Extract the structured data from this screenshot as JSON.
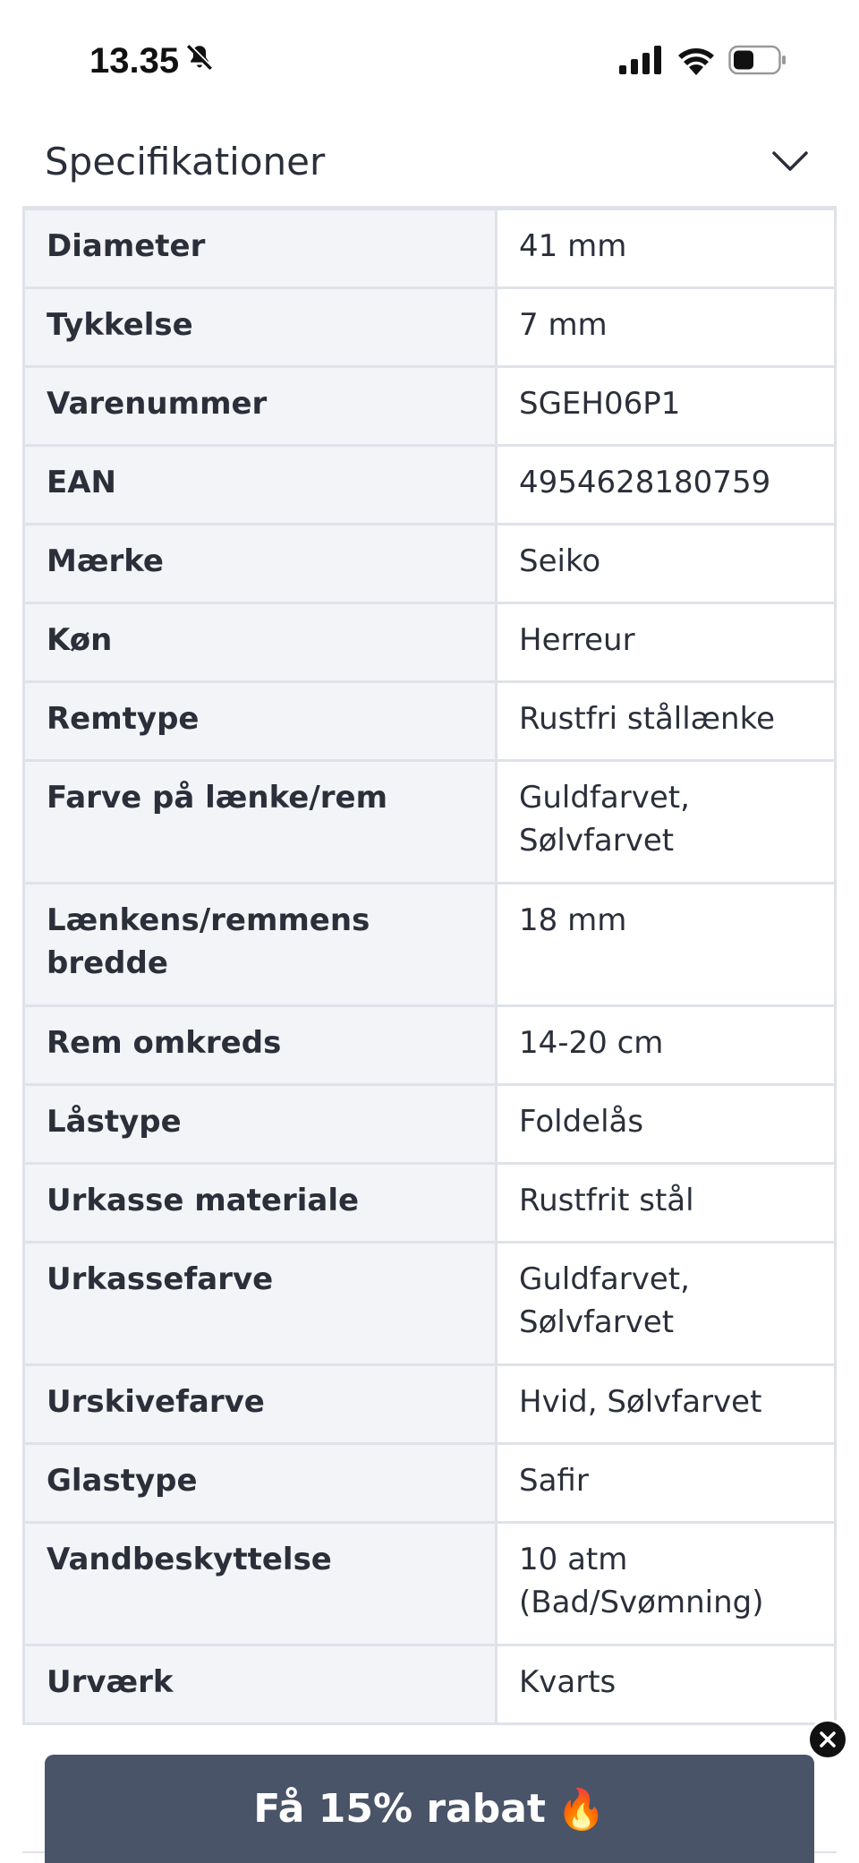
{
  "status_bar": {
    "time": "13.35",
    "icons": [
      "bell-slash-icon",
      "cellular-signal-icon",
      "wifi-icon",
      "battery-icon"
    ]
  },
  "section": {
    "title": "Specifikationer",
    "expand_icon": "chevron-down-icon"
  },
  "specs": [
    {
      "label": "Diameter",
      "value": "41 mm"
    },
    {
      "label": "Tykkelse",
      "value": "7 mm"
    },
    {
      "label": "Varenummer",
      "value": "SGEH06P1"
    },
    {
      "label": "EAN",
      "value": "4954628180759"
    },
    {
      "label": "Mærke",
      "value": "Seiko"
    },
    {
      "label": "Køn",
      "value": "Herreur"
    },
    {
      "label": "Remtype",
      "value": "Rustfri stållænke"
    },
    {
      "label": "Farve på lænke/rem",
      "value_lines": [
        "Guldfarvet,",
        "Sølvfarvet"
      ]
    },
    {
      "label_lines": [
        "Lænkens/remmens",
        "bredde"
      ],
      "value": "18 mm"
    },
    {
      "label": "Rem omkreds",
      "value": "14-20 cm"
    },
    {
      "label": "Låstype",
      "value": "Foldelås"
    },
    {
      "label": "Urkasse materiale",
      "value": "Rustfrit stål"
    },
    {
      "label": "Urkassefarve",
      "value_lines": [
        "Guldfarvet,",
        "Sølvfarvet"
      ]
    },
    {
      "label": "Urskivefarve",
      "value": "Hvid, Sølvfarvet"
    },
    {
      "label": "Glastype",
      "value": "Safir"
    },
    {
      "label": "Vandbeskyttelse",
      "value_lines": [
        "10 atm",
        "(Bad/Svømning)"
      ]
    },
    {
      "label": "Urværk",
      "value": "Kvarts"
    }
  ],
  "promo": {
    "label": "Få 15% rabat",
    "emoji": "🔥",
    "close_icon": "close-icon",
    "bg_color": "#4a5468"
  }
}
